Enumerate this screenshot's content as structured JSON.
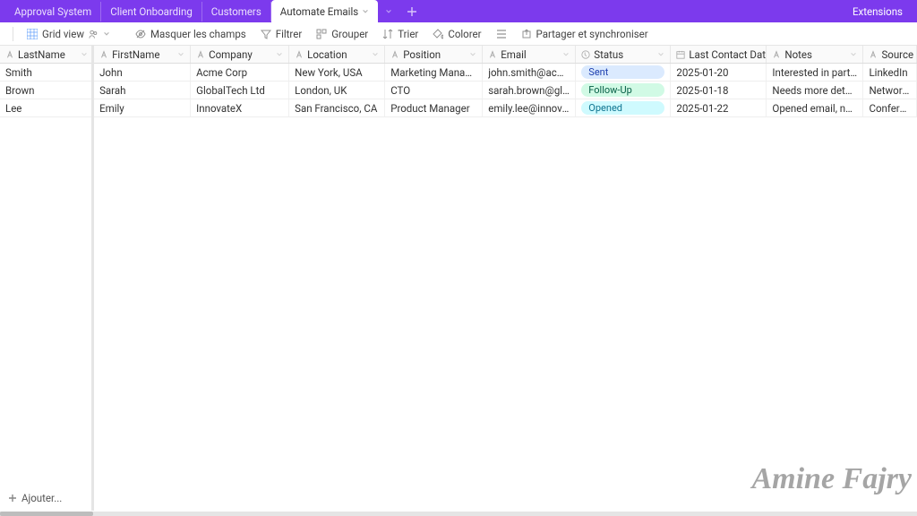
{
  "topbar": {
    "tabs": [
      {
        "label": "Approval System"
      },
      {
        "label": "Client Onboarding"
      },
      {
        "label": "Customers"
      },
      {
        "label": "Automate Emails",
        "active": true
      }
    ],
    "extensions": "Extensions"
  },
  "toolbar": {
    "grid_view": "Grid view",
    "hide_fields": "Masquer les champs",
    "filter": "Filtrer",
    "group": "Grouper",
    "sort": "Trier",
    "color": "Colorer",
    "row_height_icon": "",
    "share": "Partager et synchroniser"
  },
  "columns": [
    "LastName",
    "FirstName",
    "Company",
    "Location",
    "Position",
    "Email",
    "Status",
    "Last Contact Date",
    "Notes",
    "Source"
  ],
  "rows": [
    {
      "lastName": "Smith",
      "firstName": "John",
      "company": "Acme Corp",
      "location": "New York, USA",
      "position": "Marketing Manager",
      "email": "john.smith@acmecorp.com",
      "status": "Sent",
      "statusClass": "sent",
      "lastContact": "2025-01-20",
      "notes": "Interested in partnership",
      "source": "LinkedIn"
    },
    {
      "lastName": "Brown",
      "firstName": "Sarah",
      "company": "GlobalTech Ltd",
      "location": "London, UK",
      "position": "CTO",
      "email": "sarah.brown@globaltech....",
      "status": "Follow-Up",
      "statusClass": "follow",
      "lastContact": "2025-01-18",
      "notes": "Needs more details about...",
      "source": "Networking"
    },
    {
      "lastName": "Lee",
      "firstName": "Emily",
      "company": "InnovateX",
      "location": "San Francisco, CA",
      "position": "Product Manager",
      "email": "emily.lee@innovatex.com",
      "status": "Opened",
      "statusClass": "opened",
      "lastContact": "2025-01-22",
      "notes": "Opened email, no reply yet",
      "source": "Conference"
    }
  ],
  "footer": {
    "add_row": "Ajouter..."
  },
  "watermark": "Amine Fajry"
}
